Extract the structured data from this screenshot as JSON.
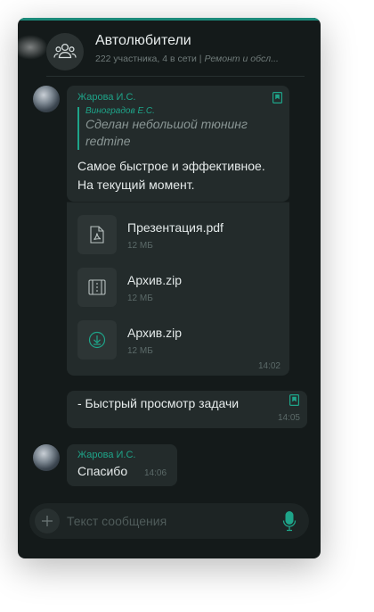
{
  "header": {
    "title": "Автолюбители",
    "subtitle_main": "222 участника, 4 в сети | ",
    "subtitle_topic": "Ремонт и обсл..."
  },
  "messages": [
    {
      "sender": "Жарова И.С.",
      "reply": {
        "author": "Виноградов Е.С.",
        "text": "Сделан небольшой тюнинг redmine"
      },
      "text": "Самое быстрое и эффективное. На текущий момент.",
      "files": [
        {
          "name": "Презентация.pdf",
          "size": "12 МБ",
          "icon": "pdf-icon"
        },
        {
          "name": "Архив.zip",
          "size": "12 МБ",
          "icon": "archive-icon"
        },
        {
          "name": "Архив.zip",
          "size": "12 МБ",
          "icon": "download-icon"
        }
      ],
      "time": "14:02",
      "bookmarked": true
    },
    {
      "text": "- Быстрый просмотр задачи",
      "time": "14:05",
      "bookmarked": true
    },
    {
      "sender": "Жарова И.С.",
      "text": "Спасибо",
      "time": "14:06"
    }
  ],
  "composer": {
    "placeholder": "Текст сообщения"
  },
  "colors": {
    "accent": "#1ea489",
    "background": "#141a1a",
    "bubble": "#232b2b"
  }
}
